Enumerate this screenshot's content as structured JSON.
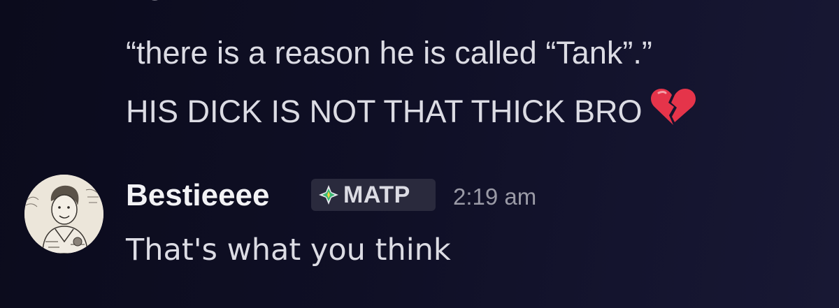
{
  "previous_message": {
    "cutoff_text": "LOLLLLLL",
    "line1": "“there is a reason he is called “Tank”.”",
    "line2": "HIS DICK IS NOT THAT THICK BRO",
    "emoji": "broken-heart"
  },
  "reply_message": {
    "username": "Bestieeee",
    "tag_label": "MATP",
    "tag_icon": "sparkle-diamond-icon",
    "timestamp": "2:19 am",
    "text": "That's what you think"
  },
  "colors": {
    "background": "#0f0f25",
    "text": "#dcdce4",
    "username": "#f2f2f5",
    "timestamp": "#9a9aa6",
    "tag_bg": "#2a2a3d",
    "heart": "#e5344a"
  }
}
